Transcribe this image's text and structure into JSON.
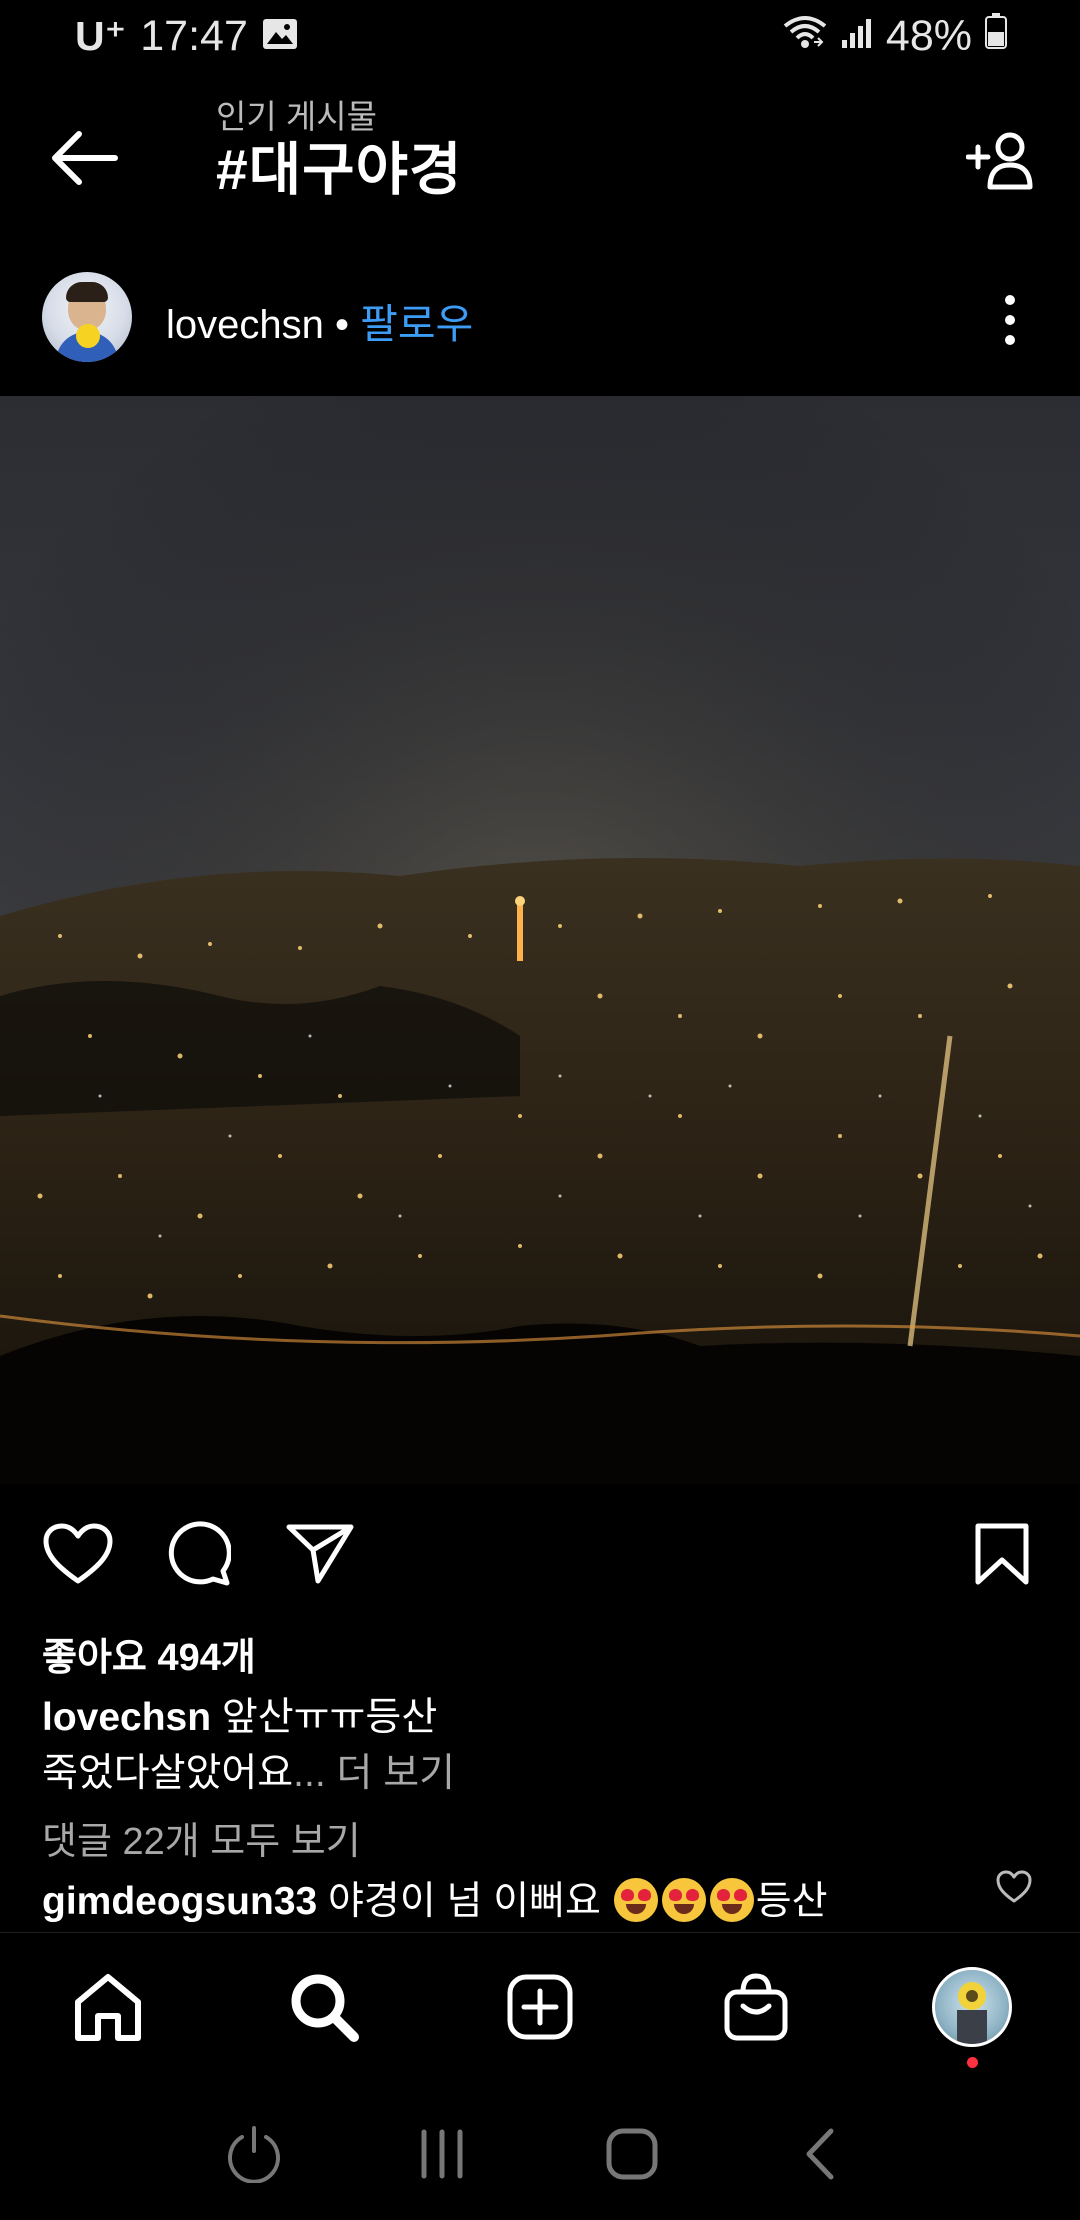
{
  "status_bar": {
    "carrier": "U⁺",
    "time": "17:47",
    "battery": "48%"
  },
  "header": {
    "subtitle": "인기 게시물",
    "title": "#대구야경"
  },
  "post": {
    "username": "lovechsn",
    "separator": " • ",
    "follow_label": "팔로우",
    "likes": "좋아요 494개",
    "caption_user": "lovechsn",
    "caption_text": " 앞산ㅠㅠ등산",
    "caption_line2": "죽었다살았어요",
    "caption_ellipsis": "... ",
    "more_label": "더 보기",
    "view_comments": "댓글 22개 모두 보기",
    "comment_user": "gimdeogsun33",
    "comment_text": " 야경이 넘 이뻐요 ",
    "comment_suffix": "등산"
  },
  "icons": {
    "back": "back-arrow-icon",
    "add_person": "add-person-icon",
    "more": "more-vertical-icon",
    "like": "heart-icon",
    "comment": "comment-icon",
    "share": "send-icon",
    "save": "bookmark-icon",
    "home": "home-icon",
    "search": "search-icon",
    "create": "plus-square-icon",
    "shop": "shopping-bag-icon"
  },
  "colors": {
    "background": "#000000",
    "link": "#3d9cf5",
    "secondary_text": "#a8a8a8",
    "notification_dot": "#ff3040"
  }
}
